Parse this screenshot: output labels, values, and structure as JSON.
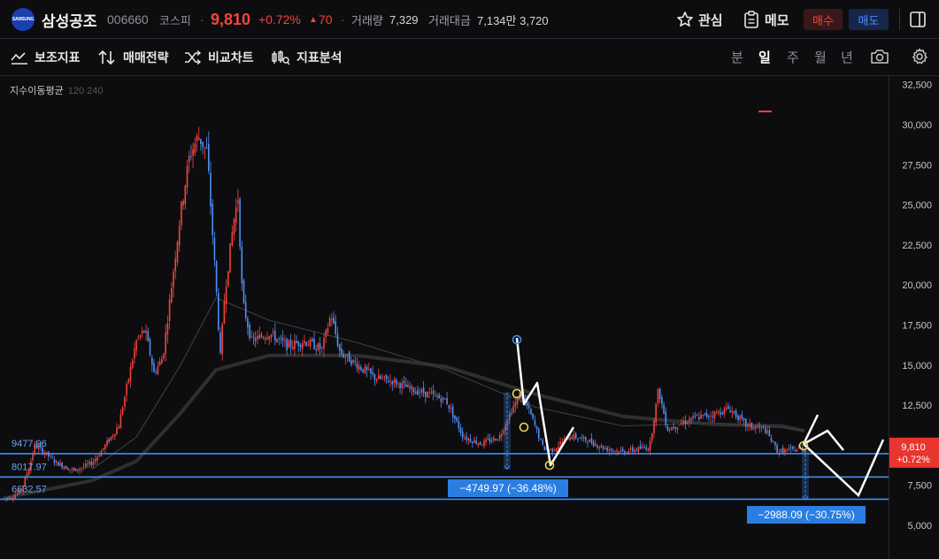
{
  "stock": {
    "logo_text": "SAMSUNG",
    "name": "삼성공조",
    "code": "006660",
    "market": "코스피",
    "price": "9,810",
    "change_pct": "+0.72%",
    "change_arrow": "▲",
    "change_abs": "70",
    "volume_label": "거래량",
    "volume": "7,329",
    "amount_label": "거래대금",
    "amount": "7,134만 3,720"
  },
  "header": {
    "favorite_label": "관심",
    "memo_label": "메모",
    "buy_label": "매수",
    "sell_label": "매도"
  },
  "toolbar": {
    "indicators": "보조지표",
    "strategy": "매매전략",
    "compare": "비교차트",
    "analysis": "지표분석",
    "periods": [
      "분",
      "일",
      "주",
      "월",
      "년"
    ],
    "active_period": "일"
  },
  "colors": {
    "up": "#f2453d",
    "down": "#4f8ff7",
    "hline": "#3d8ef0",
    "ma_long": "#3a3a3a",
    "drawing": "#ffffff",
    "marker": "#e8d84a"
  },
  "chart_data": {
    "type": "candlestick",
    "ma_legend_title": "지수이동평균",
    "ma_legend_periods": "120  240",
    "ylim": [
      5000,
      32500
    ],
    "y_ticks": [
      "5,000",
      "7,500",
      "10,000",
      "12,500",
      "15,000",
      "17,500",
      "20,000",
      "22,500",
      "25,000",
      "27,500",
      "30,000",
      "32,500"
    ],
    "y_tick_values": [
      5000,
      7500,
      10000,
      12500,
      15000,
      17500,
      20000,
      22500,
      25000,
      27500,
      30000,
      32500
    ],
    "last_price_label": "9,810",
    "last_change_label": "+0.72%",
    "last_price": 9810,
    "horizontal_lines": [
      {
        "label": "9477.96",
        "value": 9477.96
      },
      {
        "label": "8017.97",
        "value": 8017.97
      },
      {
        "label": "6632.57",
        "value": 6632.57
      }
    ],
    "measure_labels": [
      {
        "label": "−4749.97 (−36.48%)"
      },
      {
        "label": "−2988.09 (−30.75%)"
      }
    ],
    "price_path": [
      [
        0,
        6650
      ],
      [
        0.01,
        6800
      ],
      [
        0.02,
        7200
      ],
      [
        0.03,
        8800
      ],
      [
        0.035,
        10000
      ],
      [
        0.045,
        9600
      ],
      [
        0.06,
        8900
      ],
      [
        0.08,
        8400
      ],
      [
        0.1,
        8900
      ],
      [
        0.11,
        9600
      ],
      [
        0.13,
        11200
      ],
      [
        0.15,
        16500
      ],
      [
        0.16,
        17200
      ],
      [
        0.17,
        14500
      ],
      [
        0.18,
        15500
      ],
      [
        0.19,
        20000
      ],
      [
        0.2,
        24500
      ],
      [
        0.21,
        28000
      ],
      [
        0.22,
        29300
      ],
      [
        0.23,
        28300
      ],
      [
        0.24,
        20000
      ],
      [
        0.245,
        15500
      ],
      [
        0.25,
        19500
      ],
      [
        0.26,
        24000
      ],
      [
        0.265,
        25500
      ],
      [
        0.27,
        19000
      ],
      [
        0.28,
        16500
      ],
      [
        0.3,
        17000
      ],
      [
        0.32,
        16200
      ],
      [
        0.34,
        16500
      ],
      [
        0.36,
        16000
      ],
      [
        0.37,
        18200
      ],
      [
        0.38,
        15800
      ],
      [
        0.4,
        15000
      ],
      [
        0.42,
        14200
      ],
      [
        0.44,
        14000
      ],
      [
        0.46,
        13500
      ],
      [
        0.48,
        13200
      ],
      [
        0.5,
        12800
      ],
      [
        0.52,
        10500
      ],
      [
        0.54,
        10100
      ],
      [
        0.56,
        10500
      ],
      [
        0.575,
        12300
      ],
      [
        0.585,
        13200
      ],
      [
        0.595,
        12000
      ],
      [
        0.61,
        9800
      ],
      [
        0.62,
        9700
      ],
      [
        0.64,
        10600
      ],
      [
        0.66,
        10300
      ],
      [
        0.68,
        9800
      ],
      [
        0.7,
        9600
      ],
      [
        0.73,
        9900
      ],
      [
        0.74,
        13500
      ],
      [
        0.75,
        11000
      ],
      [
        0.78,
        11700
      ],
      [
        0.8,
        11900
      ],
      [
        0.82,
        12300
      ],
      [
        0.84,
        11200
      ],
      [
        0.86,
        11000
      ],
      [
        0.875,
        9600
      ],
      [
        0.89,
        9700
      ],
      [
        0.905,
        9810
      ]
    ],
    "ma_short": [
      [
        0.1,
        8500
      ],
      [
        0.15,
        10500
      ],
      [
        0.2,
        15000
      ],
      [
        0.24,
        19200
      ],
      [
        0.3,
        17800
      ],
      [
        0.4,
        16400
      ],
      [
        0.5,
        14700
      ],
      [
        0.6,
        12400
      ],
      [
        0.7,
        11200
      ],
      [
        0.8,
        11400
      ],
      [
        0.88,
        11100
      ],
      [
        0.905,
        10900
      ]
    ],
    "ma_long": [
      [
        0.0,
        6700
      ],
      [
        0.1,
        7800
      ],
      [
        0.15,
        9000
      ],
      [
        0.2,
        12000
      ],
      [
        0.24,
        14700
      ],
      [
        0.3,
        15600
      ],
      [
        0.4,
        15600
      ],
      [
        0.5,
        14900
      ],
      [
        0.6,
        13200
      ],
      [
        0.7,
        11800
      ],
      [
        0.8,
        11300
      ],
      [
        0.88,
        11200
      ],
      [
        0.905,
        10900
      ]
    ]
  }
}
